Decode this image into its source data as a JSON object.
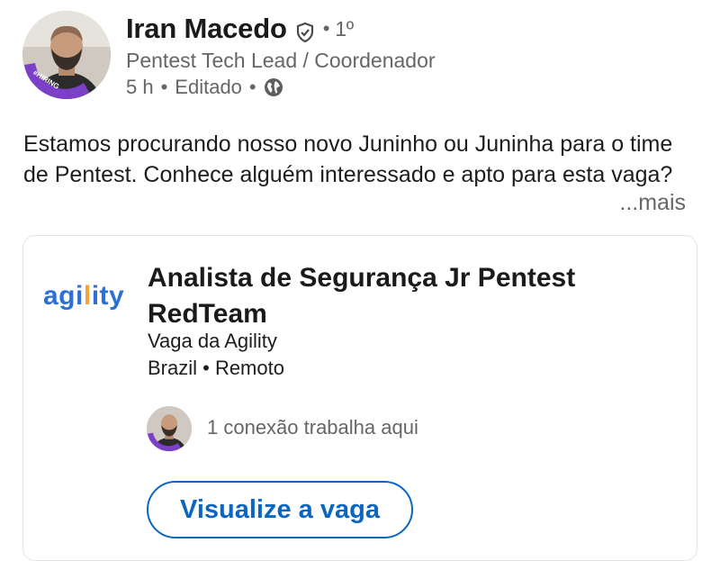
{
  "author": {
    "name": "Iran Macedo",
    "degree": "1º",
    "separator": "•",
    "headline": "Pentest Tech Lead / Coordenador",
    "time": "5 h",
    "edited": "Editado",
    "avatar_badge": "#HIRING",
    "avatar_ring_color": "#7b3fc8"
  },
  "post": {
    "text": "Estamos procurando nosso novo Juninho ou Juninha para o time de Pentest. Conhece alguém interessado e apto para esta vaga?",
    "see_more": "...mais"
  },
  "job_card": {
    "logo_text_start": "agi",
    "logo_text_tick": "l",
    "logo_text_end": "ity",
    "title": "Analista de Segurança Jr Pentest RedTeam",
    "company": "Vaga da Agility",
    "location": "Brazil • Remoto",
    "connections": "1 conexão trabalha aqui",
    "button_label": "Visualize a vaga",
    "accent_color": "#0a66c2"
  }
}
